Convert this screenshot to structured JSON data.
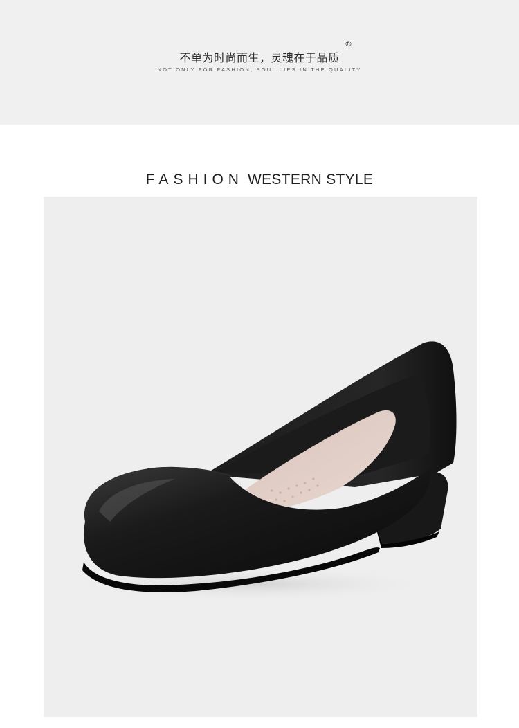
{
  "banner": {
    "slogan_cn": "不单为时尚而生，灵魂在于品质",
    "registered_mark": "®",
    "slogan_en": "NOT ONLY FOR FASHION, SOUL LIES IN THE QUALITY"
  },
  "section": {
    "title_part1": "FASHION",
    "title_part2": "WESTERN STYLE"
  },
  "product": {
    "image_subject": "black-leather-pump-shoe-icon",
    "background_color": "#eeeeee",
    "shoe_color": "#141414",
    "insole_color": "#e3cfc7"
  }
}
